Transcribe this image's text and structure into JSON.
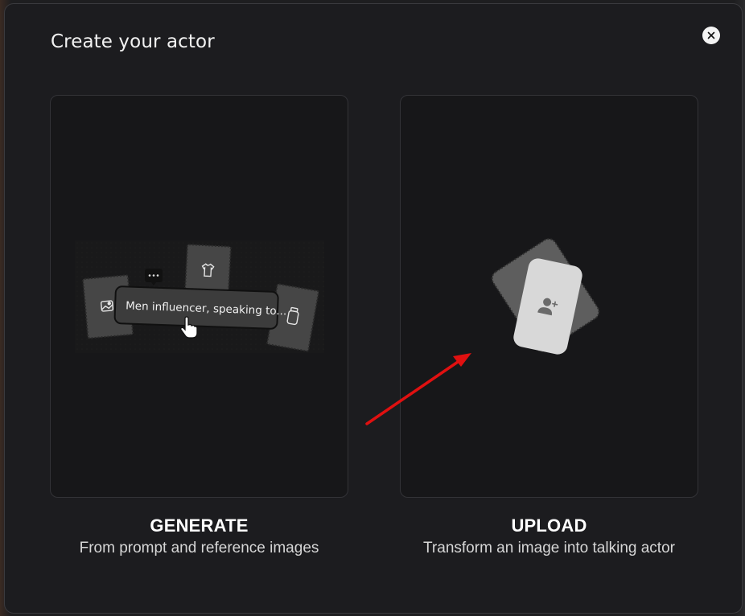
{
  "dialog": {
    "title": "Create your actor",
    "close_icon": "close-icon"
  },
  "options": [
    {
      "id": "generate",
      "title": "GENERATE",
      "description": "From prompt and reference images",
      "prompt_preview": "Men influencer, speaking to...",
      "icons": [
        "image-icon",
        "tshirt-icon",
        "bottle-icon",
        "chat-bubble-icon",
        "hand-pointer-icon"
      ]
    },
    {
      "id": "upload",
      "title": "UPLOAD",
      "description": "Transform an image into talking actor",
      "icons": [
        "add-user-icon"
      ]
    }
  ],
  "annotation": {
    "arrow_color": "#e01010"
  },
  "colors": {
    "background": "#1c1c1f",
    "card": "#171719",
    "text": "#ffffff"
  }
}
